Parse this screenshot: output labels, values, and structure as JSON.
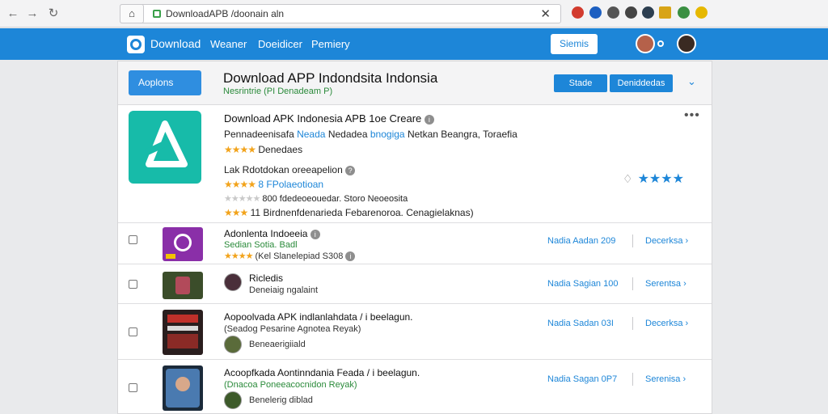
{
  "browser": {
    "url": "DownloadAPB /doonain aln",
    "home_icon": "home-icon",
    "close_icon": "x-icon"
  },
  "appbar": {
    "brand": "Download",
    "nav": [
      "Weaner",
      "Doeidicer",
      "Pemiery"
    ],
    "signin_label": "Siemis",
    "color": "#1d86d8"
  },
  "header": {
    "options_label": "Aoplons",
    "title": "Download APP Indondsita Indonsia",
    "subtitle": "Nesrintrie (PI Denadeam P)",
    "buttons": [
      "Stade",
      "Deniddedas"
    ]
  },
  "featured": {
    "title": "Download APK Indonesia APB 1oe Creare",
    "line2_prefix": "Pennadeenisafa",
    "line2_blue1": "Neada",
    "line2_mid": "Nedadea",
    "line2_blue2": "bnogiga",
    "line2_suffix": "Netkan Beangra, Toraefia",
    "rating_label": "Denedaes",
    "section_label": "Lak Rdotdokan oreeapelion",
    "section_link": "8 FPolaeotioan",
    "review_count_text": "800 fdedeoeouedar. Storo Neoeosita",
    "review_full_text": "11 Birdnenfdenarieda Febarenoroa. Cenagielaknas)",
    "accent": "#17bba9"
  },
  "rows": [
    {
      "title": "Adonlenta Indoeeia",
      "subtitle": "Sedian Sotia. Badl",
      "meta": "(Kel Slanelepiad S308",
      "link1": "Nadia Aadan 209",
      "link2": "Decerksa"
    },
    {
      "title": "Ricledis",
      "subtitle": "",
      "meta": "Deneiaig ngalaint",
      "link1": "Nadia Sagian 100",
      "link2": "Serentsa"
    },
    {
      "title": "Aopoolvada APK indlanlahdata / i beelagun.",
      "subtitle": "(Seadog Pesarine Agnotea Reyak)",
      "meta": "Beneaerigiiald",
      "link1": "Nadia Sadan 03I",
      "link2": "Decerksa"
    },
    {
      "title": "Acoopfkada Aontinndania Feada / i beelagun.",
      "subtitle": "(Dnacoa Poneeacocnidon Reyak)",
      "meta": "Benelerig diblad",
      "link1": "Nadia Sagan 0P7",
      "link2": "Serenisa"
    }
  ]
}
